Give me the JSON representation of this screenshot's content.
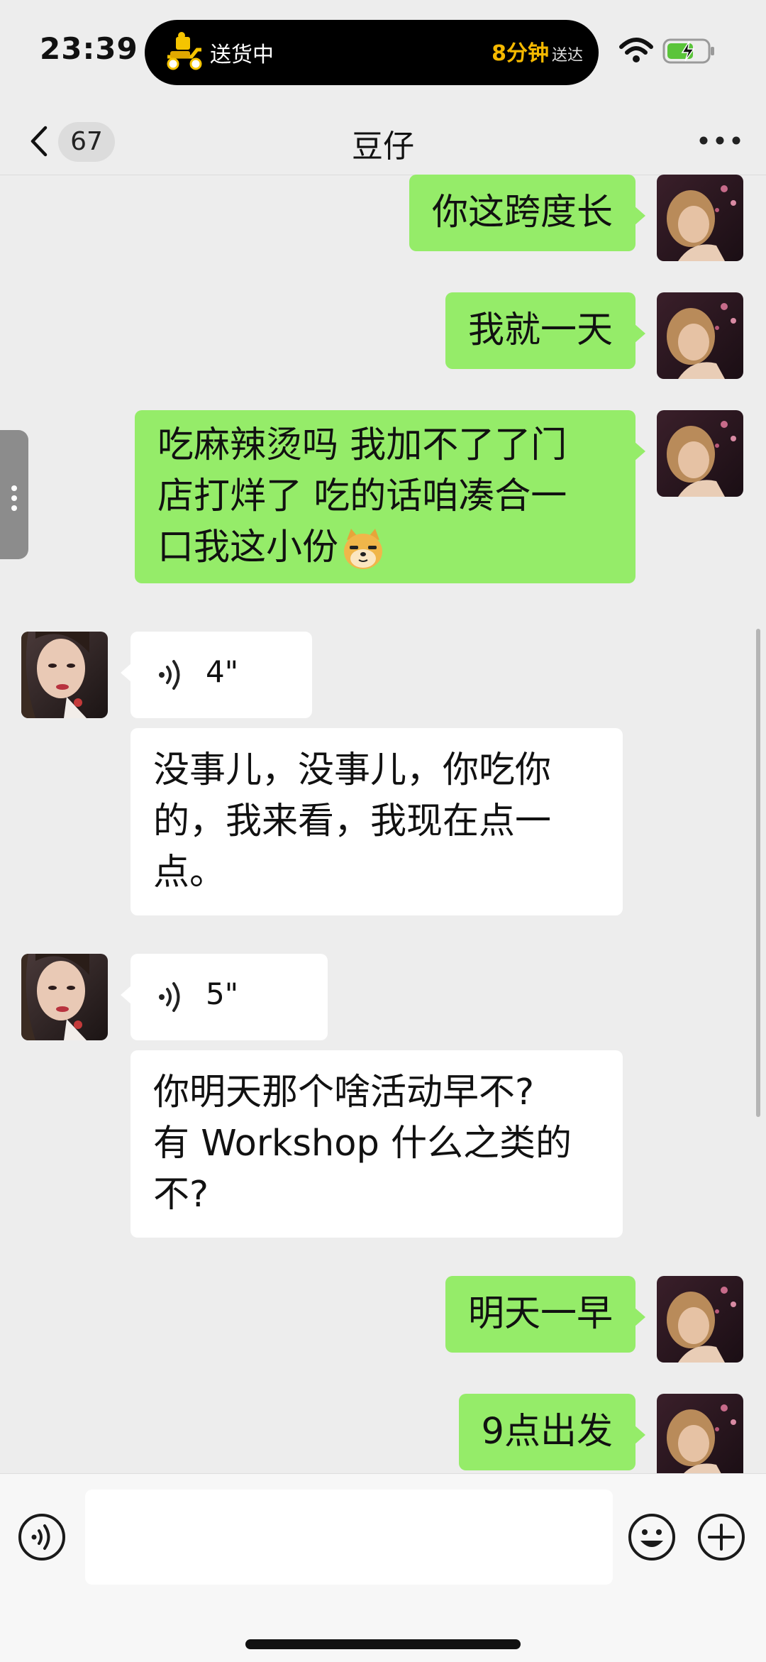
{
  "status_bar": {
    "time": "23:39",
    "live_activity": {
      "icon": "delivery-scooter-icon",
      "status": "送货中",
      "eta": "8分钟",
      "eta_suffix": "送达"
    },
    "wifi_icon": "wifi-icon",
    "battery_icon": "battery-charging-icon"
  },
  "nav": {
    "back_icon": "chevron-left-icon",
    "unread_count": "67",
    "title": "豆仔",
    "more_icon": "more-horizontal-icon"
  },
  "messages": [
    {
      "direction": "out",
      "type": "text",
      "text": "你这跨度长"
    },
    {
      "direction": "out",
      "type": "text",
      "text": "我就一天"
    },
    {
      "direction": "out",
      "type": "text",
      "lines": [
        "吃麻辣烫吗 我加不了了门",
        "店打烊了 吃的话咱凑合一",
        "口我这小份"
      ],
      "emoji": "doge-emoji"
    },
    {
      "direction": "in",
      "type": "voice",
      "duration": "4\""
    },
    {
      "direction": "in",
      "type": "text",
      "lines": [
        "没事儿，没事儿，你吃你",
        "的，我来看，我现在点一",
        "点。"
      ]
    },
    {
      "direction": "in",
      "type": "voice",
      "duration": "5\""
    },
    {
      "direction": "in",
      "type": "text",
      "lines": [
        "你明天那个啥活动早不?",
        "有 Workshop 什么之类的",
        "不?"
      ]
    },
    {
      "direction": "out",
      "type": "text",
      "text": "明天一早"
    },
    {
      "direction": "out",
      "type": "text",
      "text": "9点出发"
    }
  ],
  "input_bar": {
    "voice_icon": "voice-input-icon",
    "text_value": "",
    "emoji_icon": "emoji-smile-icon",
    "plus_icon": "plus-circle-icon"
  },
  "colors": {
    "outgoing_bubble": "#95ec69",
    "incoming_bubble": "#ffffff",
    "background": "#ededed",
    "eta_accent": "#f5b900"
  }
}
